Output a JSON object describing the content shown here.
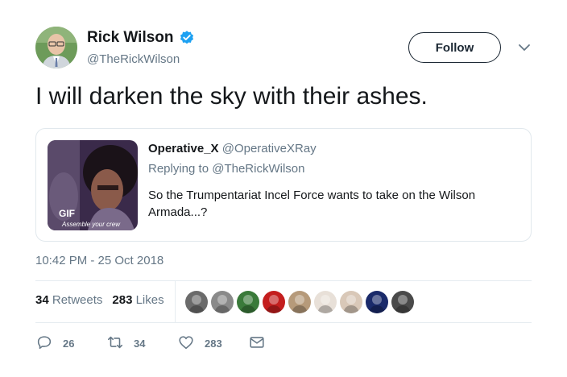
{
  "author": {
    "name": "Rick Wilson",
    "handle": "@TheRickWilson",
    "verified": true,
    "avatar_icon": "person-photo-avatar"
  },
  "follow_button": {
    "label": "Follow"
  },
  "menu_icon": "chevron-down-icon",
  "tweet_text": "I will darken the sky with their ashes.",
  "quoted_tweet": {
    "name": "Operative_X",
    "handle": "@OperativeXRay",
    "replying_to": "Replying to @TheRickWilson",
    "text": "So the Trumpentariat Incel Force wants to take on the Wilson Armada...?",
    "media": {
      "badge": "GIF",
      "caption": "Assemble your crew"
    }
  },
  "timestamp": "10:42 PM - 25 Oct 2018",
  "stats": {
    "retweets_count": "34",
    "retweets_label": "Retweets",
    "likes_count": "283",
    "likes_label": "Likes"
  },
  "likers": [
    {
      "icon": "liker-avatar-1",
      "color": "#6b6b6b"
    },
    {
      "icon": "liker-avatar-2",
      "color": "#8a8a8a"
    },
    {
      "icon": "liker-avatar-3",
      "color": "#3a7a3a"
    },
    {
      "icon": "liker-avatar-4",
      "color": "#c41e1e"
    },
    {
      "icon": "liker-avatar-5",
      "color": "#b69a7a"
    },
    {
      "icon": "liker-avatar-6",
      "color": "#e8e0d8"
    },
    {
      "icon": "liker-avatar-7",
      "color": "#d9c8b8"
    },
    {
      "icon": "liker-avatar-8",
      "color": "#1a2a6a"
    },
    {
      "icon": "liker-avatar-9",
      "color": "#4a4a4a"
    }
  ],
  "actions": {
    "reply_count": "26",
    "retweet_count": "34",
    "like_count": "283"
  },
  "colors": {
    "verified_blue": "#1da1f2",
    "text_primary": "#14171a",
    "text_secondary": "#657786",
    "border": "#e1e8ed"
  }
}
